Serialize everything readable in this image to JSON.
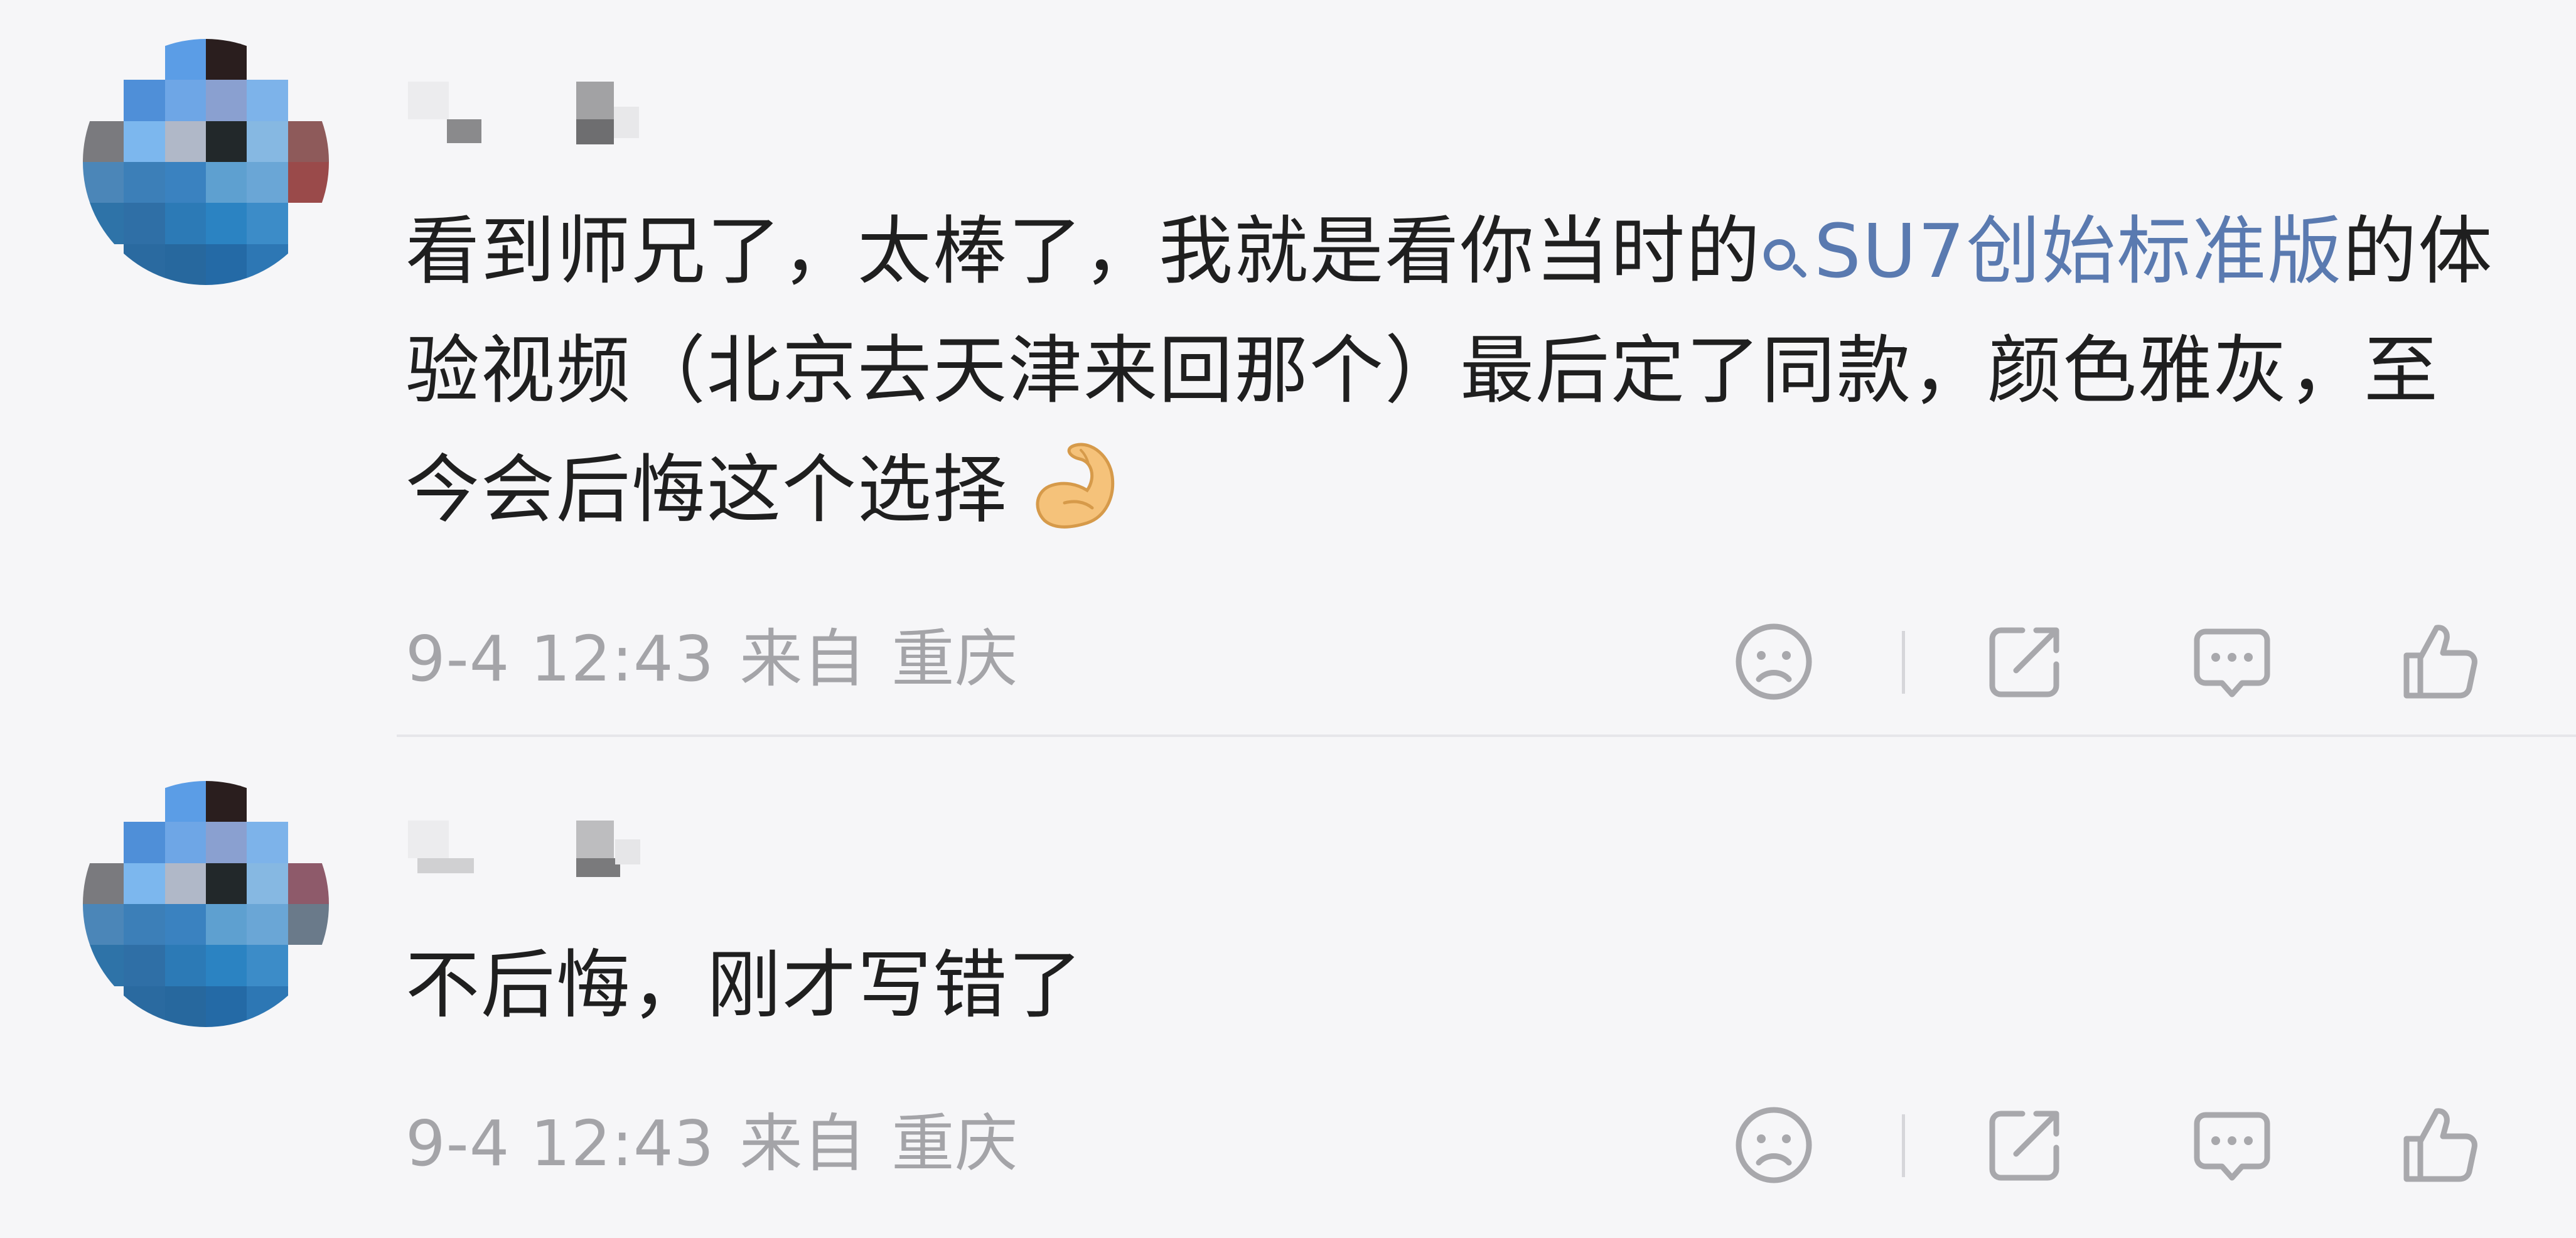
{
  "comments": [
    {
      "text_before": "看到师兄了，太棒了，我就是看你当时的",
      "link_text": "SU7创始标准版",
      "text_after": "的体验视频（北京去天津来回那个）最后定了同款，颜色雅灰，至今会后悔这个选择",
      "emoji": "flexed-biceps",
      "date": "9-4 12:43",
      "from_label": "来自",
      "location": "重庆"
    },
    {
      "text": "不后悔，刚才写错了",
      "date": "9-4 12:43",
      "from_label": "来自",
      "location": "重庆"
    }
  ],
  "actions": [
    "dislike-icon",
    "share-icon",
    "comment-icon",
    "like-icon"
  ],
  "colors": {
    "background": "#f6f6f8",
    "text": "#1f1f1f",
    "link": "#5a7ab0",
    "meta": "#a4a4a8",
    "icon": "#a8a8ac"
  }
}
